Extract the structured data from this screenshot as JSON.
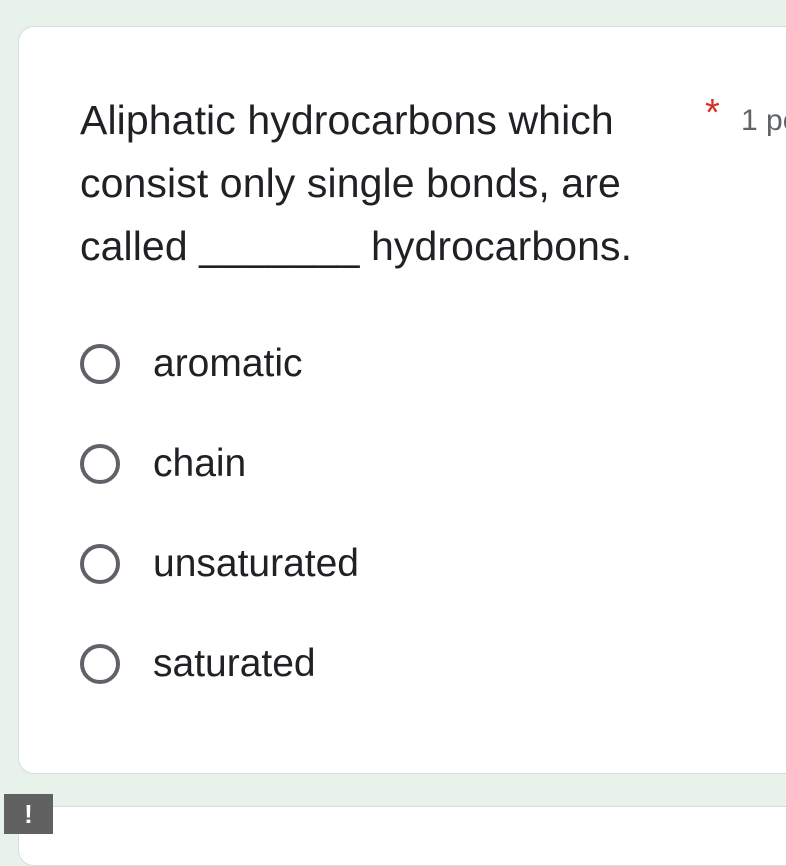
{
  "question": {
    "lines": [
      "Aliphatic hydrocarbons which",
      "consist only single bonds, are",
      "called _______ hydrocarbons."
    ],
    "required_mark": "*",
    "points": "1 po"
  },
  "options": [
    {
      "label": "aromatic",
      "selected": false
    },
    {
      "label": "chain",
      "selected": false
    },
    {
      "label": "unsaturated",
      "selected": false
    },
    {
      "label": "saturated",
      "selected": false
    }
  ],
  "badge": {
    "text": "!"
  },
  "colors": {
    "page_background": "#e6f2ea",
    "required": "#d93025",
    "radio_border": "#5f6368",
    "text": "#202124"
  }
}
